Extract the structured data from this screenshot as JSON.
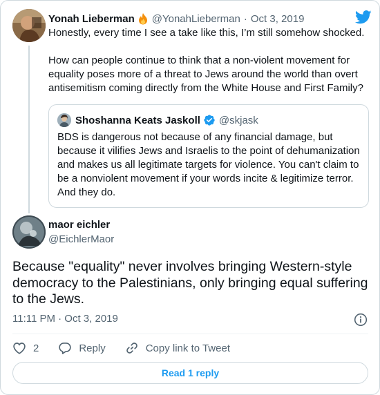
{
  "parent_tweet": {
    "display_name": "Yonah Lieberman",
    "emoji_icon": "fire-emoji",
    "handle": "@YonahLieberman",
    "separator": "·",
    "date": "Oct 3, 2019",
    "text_paragraphs": [
      "Honestly, every time I see a take like this, I’m still somehow shocked.",
      "How can people continue to think that a non-violent movement for equality poses more of a threat to Jews around the world than overt antisemitism coming directly  from the White House and First Family?"
    ],
    "quoted_tweet": {
      "display_name": "Shoshanna Keats Jaskoll",
      "verified": true,
      "handle": "@skjask",
      "text": "BDS is dangerous not because of any financial damage, but because it vilifies Jews and Israelis to the point of dehumanization and makes us all legitimate targets for violence. You can't claim to be a nonviolent movement if your words incite & legitimize terror. And they do."
    }
  },
  "main_tweet": {
    "display_name": "maor eichler",
    "handle": "@EichlerMaor",
    "text": "Because \"equality\" never involves bringing Western-style democracy to the Palestinians, only bringing equal suffering to the Jews.",
    "timestamp": "11:11 PM · Oct 3, 2019"
  },
  "actions": {
    "like_count": "2",
    "reply_label": "Reply",
    "copy_link_label": "Copy link to Tweet"
  },
  "read_replies_button": "Read 1 reply",
  "colors": {
    "accent": "#1d9bf0",
    "text_primary": "#0f1419",
    "text_secondary": "#536471",
    "border": "#cfd9de",
    "like_icon": "#536471",
    "fire": "#f4900c"
  },
  "icons": [
    "twitter-bird-icon",
    "fire-emoji-icon",
    "verified-badge-icon",
    "info-icon",
    "heart-icon",
    "reply-bubble-icon",
    "link-icon"
  ]
}
